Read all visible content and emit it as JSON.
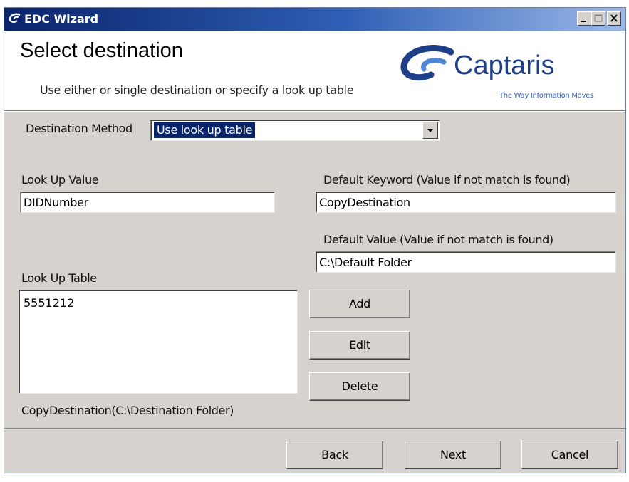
{
  "window": {
    "title": "EDC Wizard",
    "caption_buttons": [
      "minimize",
      "maximize",
      "close"
    ]
  },
  "header": {
    "heading": "Select destination",
    "subheading": "Use either or single destination or specify a look up table",
    "logo": {
      "name": "Captaris",
      "tagline": "The Way Information Moves",
      "brand_color": "#1e3f86"
    }
  },
  "form": {
    "destination_method": {
      "label": "Destination Method",
      "selected": "Use look up table"
    },
    "lookup_value": {
      "label": "Look Up Value",
      "value": "DIDNumber"
    },
    "default_keyword": {
      "label": "Default Keyword (Value if not match is found)",
      "value": "CopyDestination"
    },
    "default_value": {
      "label": "Default Value (Value if not match is found)",
      "value": "C:\\Default Folder"
    },
    "lookup_table": {
      "label": "Look Up Table",
      "items": [
        "5551212"
      ],
      "selected_detail": "CopyDestination(C:\\Destination  Folder)"
    },
    "buttons": {
      "add": "Add",
      "edit": "Edit",
      "delete": "Delete"
    }
  },
  "footer": {
    "back": "Back",
    "next": "Next",
    "cancel": "Cancel"
  },
  "colors": {
    "titlebar": "#0a246a",
    "face": "#d6d3ce",
    "selection": "#0a246a"
  }
}
